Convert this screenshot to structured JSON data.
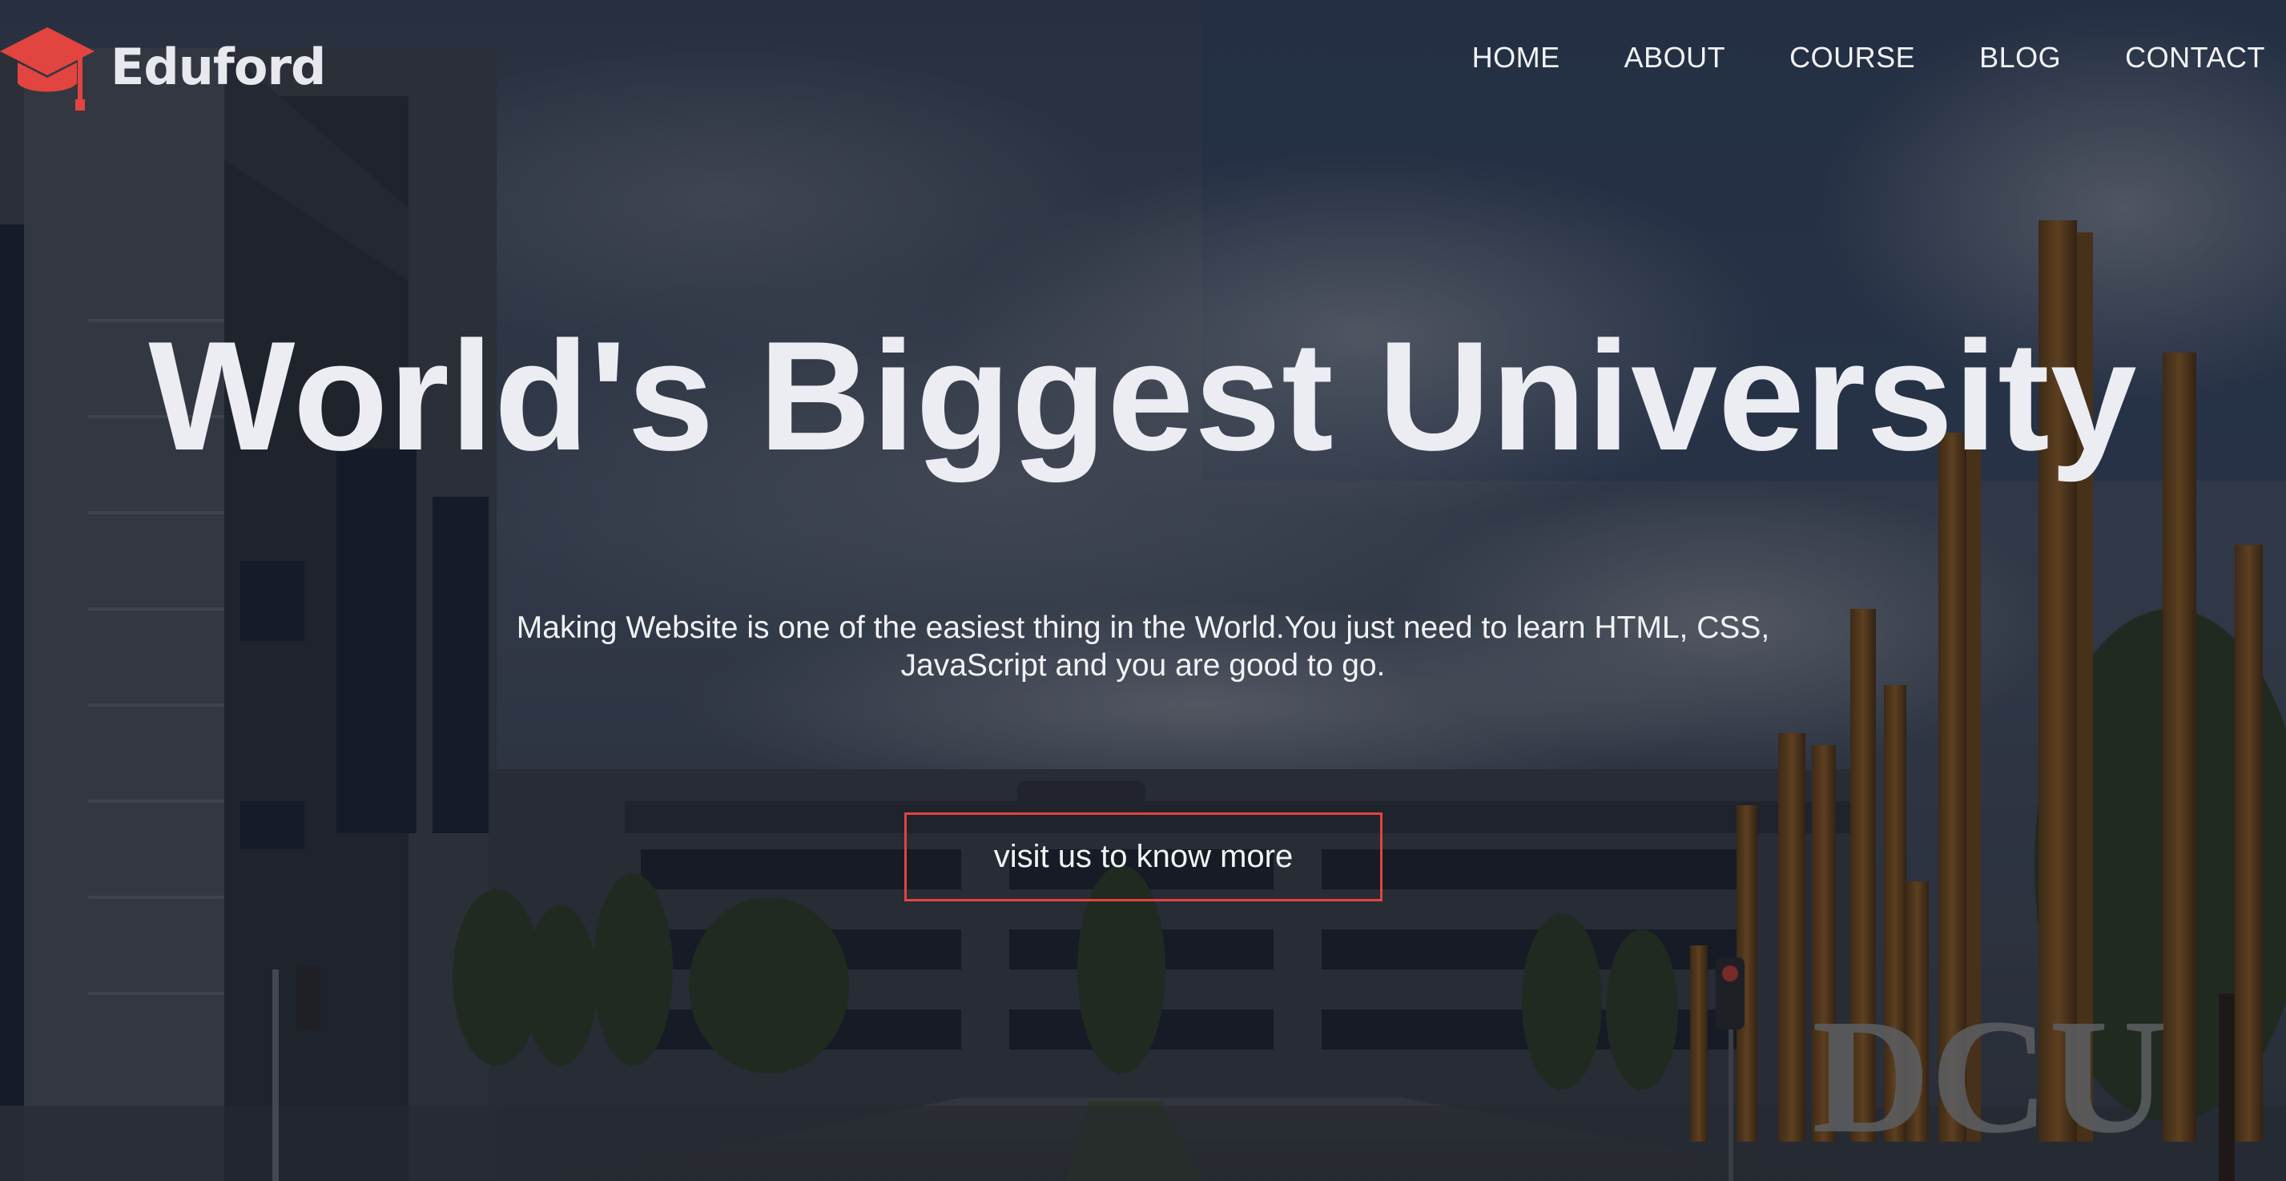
{
  "brand": {
    "name": "Eduford",
    "logo_icon": "graduation-cap-icon",
    "accent_color": "#e2443f"
  },
  "nav": {
    "items": [
      {
        "label": "HOME"
      },
      {
        "label": "ABOUT"
      },
      {
        "label": "COURSE"
      },
      {
        "label": "BLOG"
      },
      {
        "label": "CONTACT"
      }
    ]
  },
  "hero": {
    "title": "World's Biggest University",
    "subtitle_line1": "Making Website is one of the easiest thing in the World.You just need to learn HTML, CSS,",
    "subtitle_line2": "JavaScript and you are good to go.",
    "cta_label": "visit us to know more",
    "sign_text": "DCU"
  }
}
